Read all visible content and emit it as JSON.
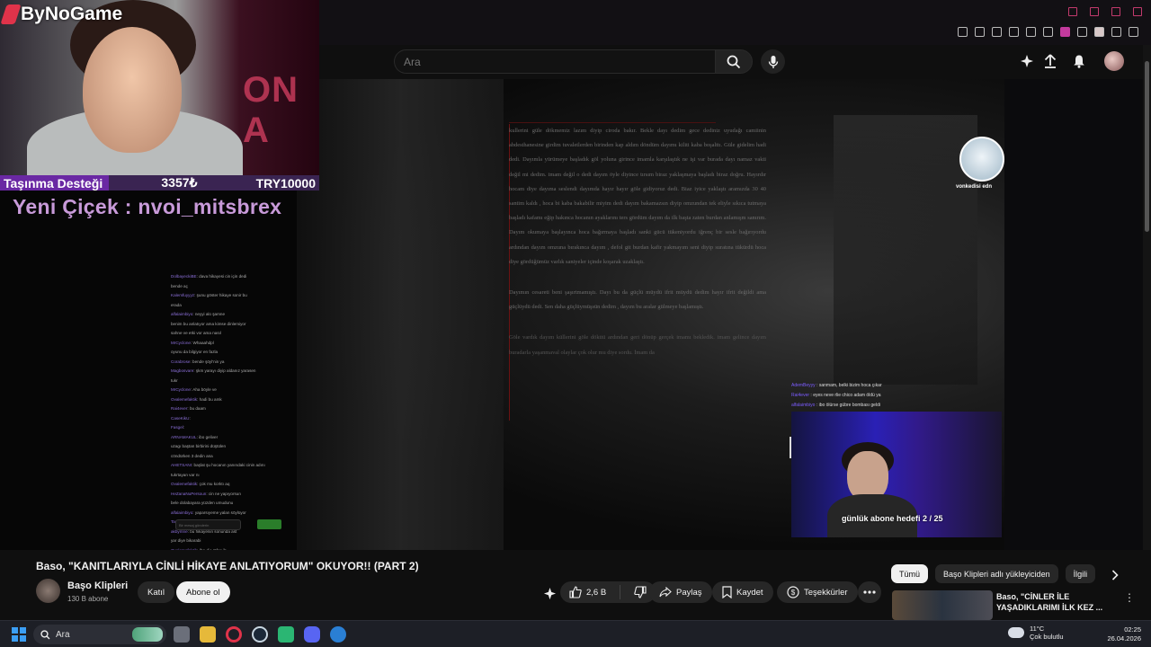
{
  "overlay": {
    "logo_text": "ByNoGame",
    "cam_wall_text": "ON A",
    "donation": {
      "label": "Taşınma Desteği",
      "current": "3357₺",
      "goal": "TRY10000",
      "progress_fraction": 0.34
    },
    "latest_follower": "Yeni Çiçek : nvoi_mitsbrex",
    "streamer_cam_caption": "günlük abone hedefi 2 / 25",
    "cat_avatar_label": "vonkedisi edn"
  },
  "youtube_header": {
    "search_placeholder": "Ara"
  },
  "stream_chat": [
    {
      "user": "AdemBeyyy",
      "text": "sanmam, belki bizim hoca çıkar"
    },
    {
      "user": "Rai4ever",
      "text": "eyes neve rlie chico adam öldü ya"
    },
    {
      "user": "alfalaimbiyo",
      "text": "ibo ölürse gübre bombası geldi"
    }
  ],
  "chat_overlay_lines": [
    {
      "user": "DolbayeckiBE",
      "text": "dava hikayesi cin için dedi"
    },
    {
      "user": "",
      "text": "bende aç"
    },
    {
      "user": "Kalemfuyyyz",
      "text": "şunu göster hikaye sonir bu"
    },
    {
      "user": "",
      "text": "erada"
    },
    {
      "user": "alfalaimbiyo",
      "text": "neyyi alo şamne"
    },
    {
      "user": "",
      "text": "benim bu anlatıyor ama kimse dinlemiyor"
    },
    {
      "user": "",
      "text": "sahne ve etki vor ama nasıl"
    },
    {
      "user": "MrCyclone",
      "text": "Whaaahdpl"
    },
    {
      "user": "",
      "text": "oyunu da bilgiyor en fazla"
    },
    {
      "user": "Corabrose",
      "text": "bende şöyl'nin ya"
    },
    {
      "user": "Magbosvare",
      "text": "şkm yarayı diyip aldanız yarasen"
    },
    {
      "user": "",
      "text": "tukr"
    },
    {
      "user": "MrCyclone",
      "text": "Aha böyle ve"
    },
    {
      "user": "Ovalemefaktik",
      "text": "hadi bu amk"
    },
    {
      "user": "Rai4ever",
      "text": "bu daam"
    },
    {
      "user": "CaseKikU",
      "text": ""
    },
    {
      "user": "Fasgel",
      "text": ""
    },
    {
      "user": "ARNAMAKUL",
      "text": "ibo geliver"
    },
    {
      "user": "",
      "text": "uzagı baştan birbirini düştülen"
    },
    {
      "user": "",
      "text": "cöndürken 3 dedin ana"
    },
    {
      "user": "AHETSANI",
      "text": "başlat şu hocanın yanındaki cinin adını"
    },
    {
      "user": "",
      "text": "tukrtayan var nı"
    },
    {
      "user": "Ovalemefaktik",
      "text": "çok mu korktı aq"
    },
    {
      "user": "HeZanaNuPersoun",
      "text": "cin ne yapıyorsun"
    },
    {
      "user": "",
      "text": "bele dolabayara yüzden umudunu"
    },
    {
      "user": "alfalaimbiyo",
      "text": "yaparsıyeme yalan söylüyor"
    },
    {
      "user": "Tamam_Kad",
      "text": "Bime ibo Bime bo"
    },
    {
      "user": "akbymne",
      "text": "bu hikayenin sonunda ast"
    },
    {
      "user": "",
      "text": "yar diye bikarabi"
    },
    {
      "user": "Ovalemefaktik",
      "text": "İbo di Lütfen ib"
    },
    {
      "user": "",
      "text": "nakıtonon genel cin isteryüzü kalmadı"
    },
    {
      "user": "AdemBeyyy",
      "text": "sanmam, belki bizim hoca çıkar"
    },
    {
      "user": "Rai4ever",
      "text": "eyes neve rlie chico adam öldü ya"
    },
    {
      "user": "alfalaimbiyo",
      "text": "ibo ölürse gübre bombası geldi"
    }
  ],
  "chat_overlay_input": {
    "placeholder": "Bir mesaj gönderin",
    "section_label": "Yazışmalar Özet"
  },
  "article": {
    "paragraphs": [
      "kullerini güle dökmemiz lazım diyip ciroda bakır. Bekle dayı dedim gece dediniz uyudağı camiinin abdesthanesine girdim tuvaletlerden birinden kap aldım döndüm dayımı kiliti kaba boşalttı. Güle gidelim hadi dedi. Dayımla yürümeye başladık göl yoluna girince imamla karşılaştık ne işi var burada dayı namaz vakti değil mi dedim. imam değil o dedi dayım öyle diyince tırsım biraz yaklaşmaya başladı biraz doğru. Hayırdır hocam diye dayıma seslendi dayımda hayır hayır göle gidiyoruz dedi. Biaz iyice yaklaştı aramızda 30 40 santim kaldı , hoca bi kaba bakabilir miyim dedi dayım bakamazsın diyip omzundan tek eliyle sıkıca tutmaya başladı kafamı eğip hakınca hocanın ayaklarını ters gördüm dayım da ilk başta zaten burdan anlamışm sanırım. Dayım okumaya başlayınca hoca bağırmaya başladı sanki gücü tükeniyordu iğrenç bir sesle bağırıyordu ardından dayım omzuna bırakınca dayım , defol git burdan kafir yakmayım seni diyip suratına tükürdü hoca diye gördüğümüz varlık saniyeler içinde koşarak uzaklaştı.",
      "Dayımın cesareti beni şaşırtmamıştı. Dayı bu da güçlü müydü ifrit müydü dedim hayır ifrit değildi ama güçlüydü dedi. Sen daha güçlüymüşsün dedim , dayım bu aralar gülmeye başlamıştı.",
      "Göle vardık dayım küllerini göle dökttü ardından geri dönüp gerçek imamı bekledik. imam gelince dayım buradarla yaşanmaval olaylar çok olur mu diye sordu. İmam da"
    ]
  },
  "video": {
    "title": "Baso, \"KANITLARIYLA CİNLİ HİKAYE ANLATIYORUM\" OKUYOR!! (PART 2)",
    "channel_name": "Başo Klipleri",
    "subscribers": "130 B abone",
    "join_label": "Katıl",
    "subscribe_label": "Abone ol",
    "like_count": "2,6 B",
    "share_label": "Paylaş",
    "save_label": "Kaydet",
    "thanks_label": "Teşekkürler"
  },
  "recommendations": {
    "chips": [
      "Tümü",
      "Başo Klipleri adlı yükleyiciden",
      "İlgili"
    ],
    "active_chip": "Tümü",
    "first_title": "Baso, \"CİNLER İLE YAŞADIKLARIMI İLK KEZ ..."
  },
  "taskbar": {
    "search_text": "Ara",
    "weather_temp": "11°C",
    "weather_desc": "Çok bulutlu",
    "time": "02:25",
    "date": "26.04.2026"
  },
  "colors": {
    "accent_red": "#e0334a",
    "overlay_purple": "#8a2bdb",
    "chat_username": "#7c5cff",
    "youtube_bg": "#0f0f0f"
  }
}
